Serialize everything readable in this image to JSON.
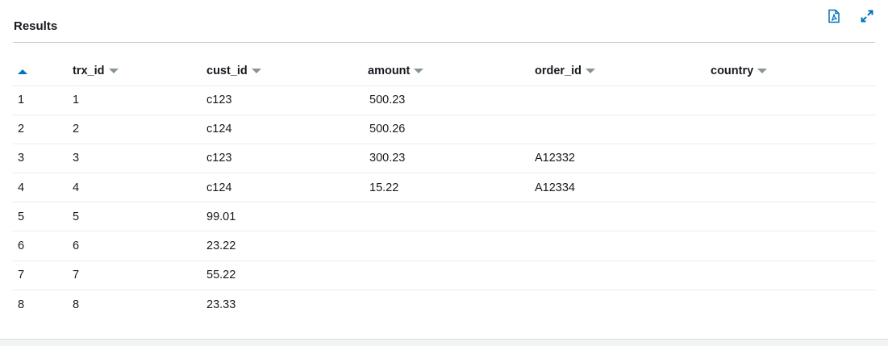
{
  "panel": {
    "title": "Results",
    "icons": {
      "pdf": "pdf-icon",
      "expand": "expand-icon"
    },
    "accent_color": "#0073bb"
  },
  "table": {
    "sort_indicator": "sort-ascending-icon",
    "columns": [
      "trx_id",
      "cust_id",
      "amount",
      "order_id",
      "country"
    ],
    "rows": [
      {
        "index": "1",
        "trx_id": "1",
        "cust_id": "c123",
        "amount": "500.23",
        "order_id": "",
        "country": ""
      },
      {
        "index": "2",
        "trx_id": "2",
        "cust_id": "c124",
        "amount": "500.26",
        "order_id": "",
        "country": ""
      },
      {
        "index": "3",
        "trx_id": "3",
        "cust_id": "c123",
        "amount": "300.23",
        "order_id": "A12332",
        "country": ""
      },
      {
        "index": "4",
        "trx_id": "4",
        "cust_id": "c124",
        "amount": "15.22",
        "order_id": "A12334",
        "country": ""
      },
      {
        "index": "5",
        "trx_id": "5",
        "cust_id": "99.01",
        "amount": "",
        "order_id": "",
        "country": ""
      },
      {
        "index": "6",
        "trx_id": "6",
        "cust_id": "23.22",
        "amount": "",
        "order_id": "",
        "country": ""
      },
      {
        "index": "7",
        "trx_id": "7",
        "cust_id": "55.22",
        "amount": "",
        "order_id": "",
        "country": ""
      },
      {
        "index": "8",
        "trx_id": "8",
        "cust_id": "23.33",
        "amount": "",
        "order_id": "",
        "country": ""
      }
    ]
  }
}
